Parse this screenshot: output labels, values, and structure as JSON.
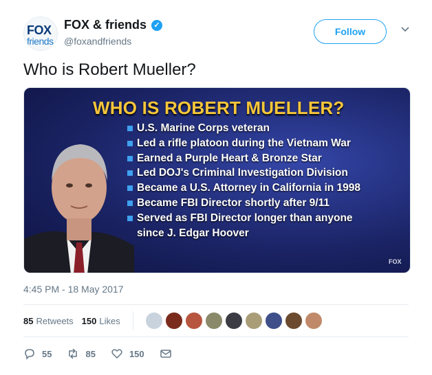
{
  "header": {
    "avatar": {
      "top_text": "FOX",
      "bottom_text": "friends"
    },
    "name": "FOX & friends",
    "handle": "@foxandfriends",
    "follow_label": "Follow"
  },
  "tweet": {
    "text": "Who is Robert Mueller?",
    "timestamp": "4:45 PM - 18 May 2017"
  },
  "media": {
    "title": "WHO IS ROBERT MUELLER?",
    "bullets": [
      "U.S. Marine Corps veteran",
      "Led a rifle platoon during the Vietnam War",
      "Earned a Purple Heart & Bronze Star",
      "Led DOJ's Criminal Investigation Division",
      "Became a U.S. Attorney in California in 1998",
      "Became FBI Director shortly after 9/11",
      "Served as FBI Director longer than anyone since J. Edgar Hoover"
    ],
    "logo_text": "FOX"
  },
  "stats": {
    "retweets_count": "85",
    "retweets_label": "Retweets",
    "likes_count": "150",
    "likes_label": "Likes"
  },
  "actions": {
    "reply_count": "55",
    "retweet_count": "85",
    "like_count": "150"
  },
  "colors": {
    "accent": "#1da1f2",
    "title_yellow": "#f6c63a",
    "media_bg": "#1b2466"
  },
  "icons": [
    "verified-icon",
    "chevron-down-icon",
    "reply-icon",
    "retweet-icon",
    "heart-icon",
    "message-icon"
  ]
}
